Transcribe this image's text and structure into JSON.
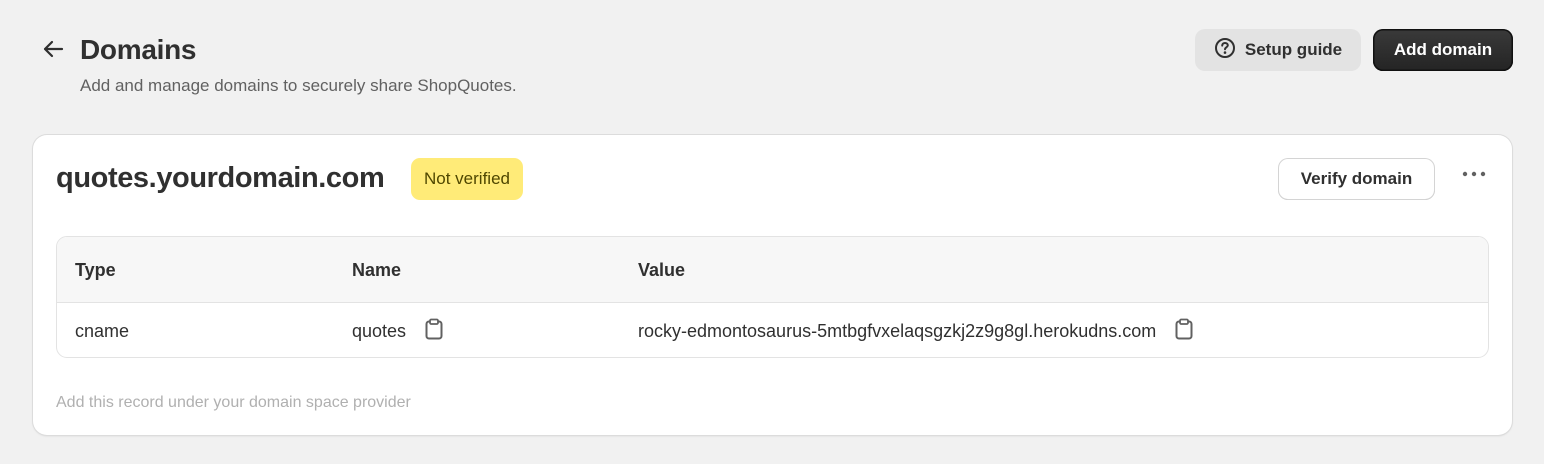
{
  "header": {
    "title": "Domains",
    "subtitle": "Add and manage domains to securely share ShopQuotes.",
    "back_icon": "arrow-left-icon",
    "setup_guide_label": "Setup guide",
    "setup_guide_icon": "question-circle-icon",
    "add_domain_label": "Add domain"
  },
  "domain": {
    "name": "quotes.yourdomain.com",
    "status": "Not verified",
    "status_color": "#ffeb78",
    "verify_label": "Verify domain",
    "menu_icon": "ellipsis-horizontal-icon"
  },
  "table": {
    "columns": [
      "Type",
      "Name",
      "Value"
    ],
    "rows": [
      {
        "type": "cname",
        "name": "quotes",
        "value": "rocky-edmontosaurus-5mtbgfvxelaqsgzkj2z9g8gl.herokudns.com"
      }
    ],
    "copy_icon": "clipboard-icon"
  },
  "footnote": "Add this record under your domain space provider",
  "colors": {
    "page_bg": "#f1f1f1",
    "card_bg": "#ffffff",
    "primary_button": "#303030",
    "badge_warning": "#ffeb78"
  }
}
